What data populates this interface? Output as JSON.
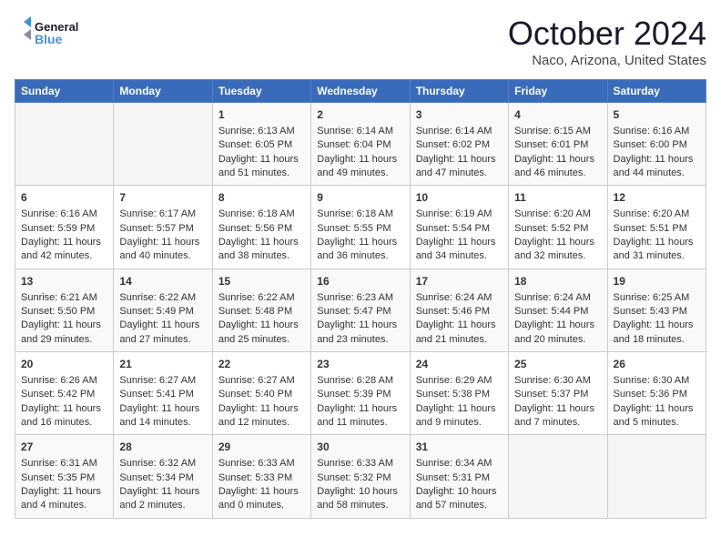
{
  "header": {
    "logo_line1": "General",
    "logo_line2": "Blue",
    "month_title": "October 2024",
    "location": "Naco, Arizona, United States"
  },
  "weekdays": [
    "Sunday",
    "Monday",
    "Tuesday",
    "Wednesday",
    "Thursday",
    "Friday",
    "Saturday"
  ],
  "weeks": [
    [
      {
        "day": "",
        "content": ""
      },
      {
        "day": "",
        "content": ""
      },
      {
        "day": "1",
        "content": "Sunrise: 6:13 AM\nSunset: 6:05 PM\nDaylight: 11 hours and 51 minutes."
      },
      {
        "day": "2",
        "content": "Sunrise: 6:14 AM\nSunset: 6:04 PM\nDaylight: 11 hours and 49 minutes."
      },
      {
        "day": "3",
        "content": "Sunrise: 6:14 AM\nSunset: 6:02 PM\nDaylight: 11 hours and 47 minutes."
      },
      {
        "day": "4",
        "content": "Sunrise: 6:15 AM\nSunset: 6:01 PM\nDaylight: 11 hours and 46 minutes."
      },
      {
        "day": "5",
        "content": "Sunrise: 6:16 AM\nSunset: 6:00 PM\nDaylight: 11 hours and 44 minutes."
      }
    ],
    [
      {
        "day": "6",
        "content": "Sunrise: 6:16 AM\nSunset: 5:59 PM\nDaylight: 11 hours and 42 minutes."
      },
      {
        "day": "7",
        "content": "Sunrise: 6:17 AM\nSunset: 5:57 PM\nDaylight: 11 hours and 40 minutes."
      },
      {
        "day": "8",
        "content": "Sunrise: 6:18 AM\nSunset: 5:56 PM\nDaylight: 11 hours and 38 minutes."
      },
      {
        "day": "9",
        "content": "Sunrise: 6:18 AM\nSunset: 5:55 PM\nDaylight: 11 hours and 36 minutes."
      },
      {
        "day": "10",
        "content": "Sunrise: 6:19 AM\nSunset: 5:54 PM\nDaylight: 11 hours and 34 minutes."
      },
      {
        "day": "11",
        "content": "Sunrise: 6:20 AM\nSunset: 5:52 PM\nDaylight: 11 hours and 32 minutes."
      },
      {
        "day": "12",
        "content": "Sunrise: 6:20 AM\nSunset: 5:51 PM\nDaylight: 11 hours and 31 minutes."
      }
    ],
    [
      {
        "day": "13",
        "content": "Sunrise: 6:21 AM\nSunset: 5:50 PM\nDaylight: 11 hours and 29 minutes."
      },
      {
        "day": "14",
        "content": "Sunrise: 6:22 AM\nSunset: 5:49 PM\nDaylight: 11 hours and 27 minutes."
      },
      {
        "day": "15",
        "content": "Sunrise: 6:22 AM\nSunset: 5:48 PM\nDaylight: 11 hours and 25 minutes."
      },
      {
        "day": "16",
        "content": "Sunrise: 6:23 AM\nSunset: 5:47 PM\nDaylight: 11 hours and 23 minutes."
      },
      {
        "day": "17",
        "content": "Sunrise: 6:24 AM\nSunset: 5:46 PM\nDaylight: 11 hours and 21 minutes."
      },
      {
        "day": "18",
        "content": "Sunrise: 6:24 AM\nSunset: 5:44 PM\nDaylight: 11 hours and 20 minutes."
      },
      {
        "day": "19",
        "content": "Sunrise: 6:25 AM\nSunset: 5:43 PM\nDaylight: 11 hours and 18 minutes."
      }
    ],
    [
      {
        "day": "20",
        "content": "Sunrise: 6:26 AM\nSunset: 5:42 PM\nDaylight: 11 hours and 16 minutes."
      },
      {
        "day": "21",
        "content": "Sunrise: 6:27 AM\nSunset: 5:41 PM\nDaylight: 11 hours and 14 minutes."
      },
      {
        "day": "22",
        "content": "Sunrise: 6:27 AM\nSunset: 5:40 PM\nDaylight: 11 hours and 12 minutes."
      },
      {
        "day": "23",
        "content": "Sunrise: 6:28 AM\nSunset: 5:39 PM\nDaylight: 11 hours and 11 minutes."
      },
      {
        "day": "24",
        "content": "Sunrise: 6:29 AM\nSunset: 5:38 PM\nDaylight: 11 hours and 9 minutes."
      },
      {
        "day": "25",
        "content": "Sunrise: 6:30 AM\nSunset: 5:37 PM\nDaylight: 11 hours and 7 minutes."
      },
      {
        "day": "26",
        "content": "Sunrise: 6:30 AM\nSunset: 5:36 PM\nDaylight: 11 hours and 5 minutes."
      }
    ],
    [
      {
        "day": "27",
        "content": "Sunrise: 6:31 AM\nSunset: 5:35 PM\nDaylight: 11 hours and 4 minutes."
      },
      {
        "day": "28",
        "content": "Sunrise: 6:32 AM\nSunset: 5:34 PM\nDaylight: 11 hours and 2 minutes."
      },
      {
        "day": "29",
        "content": "Sunrise: 6:33 AM\nSunset: 5:33 PM\nDaylight: 11 hours and 0 minutes."
      },
      {
        "day": "30",
        "content": "Sunrise: 6:33 AM\nSunset: 5:32 PM\nDaylight: 10 hours and 58 minutes."
      },
      {
        "day": "31",
        "content": "Sunrise: 6:34 AM\nSunset: 5:31 PM\nDaylight: 10 hours and 57 minutes."
      },
      {
        "day": "",
        "content": ""
      },
      {
        "day": "",
        "content": ""
      }
    ]
  ]
}
